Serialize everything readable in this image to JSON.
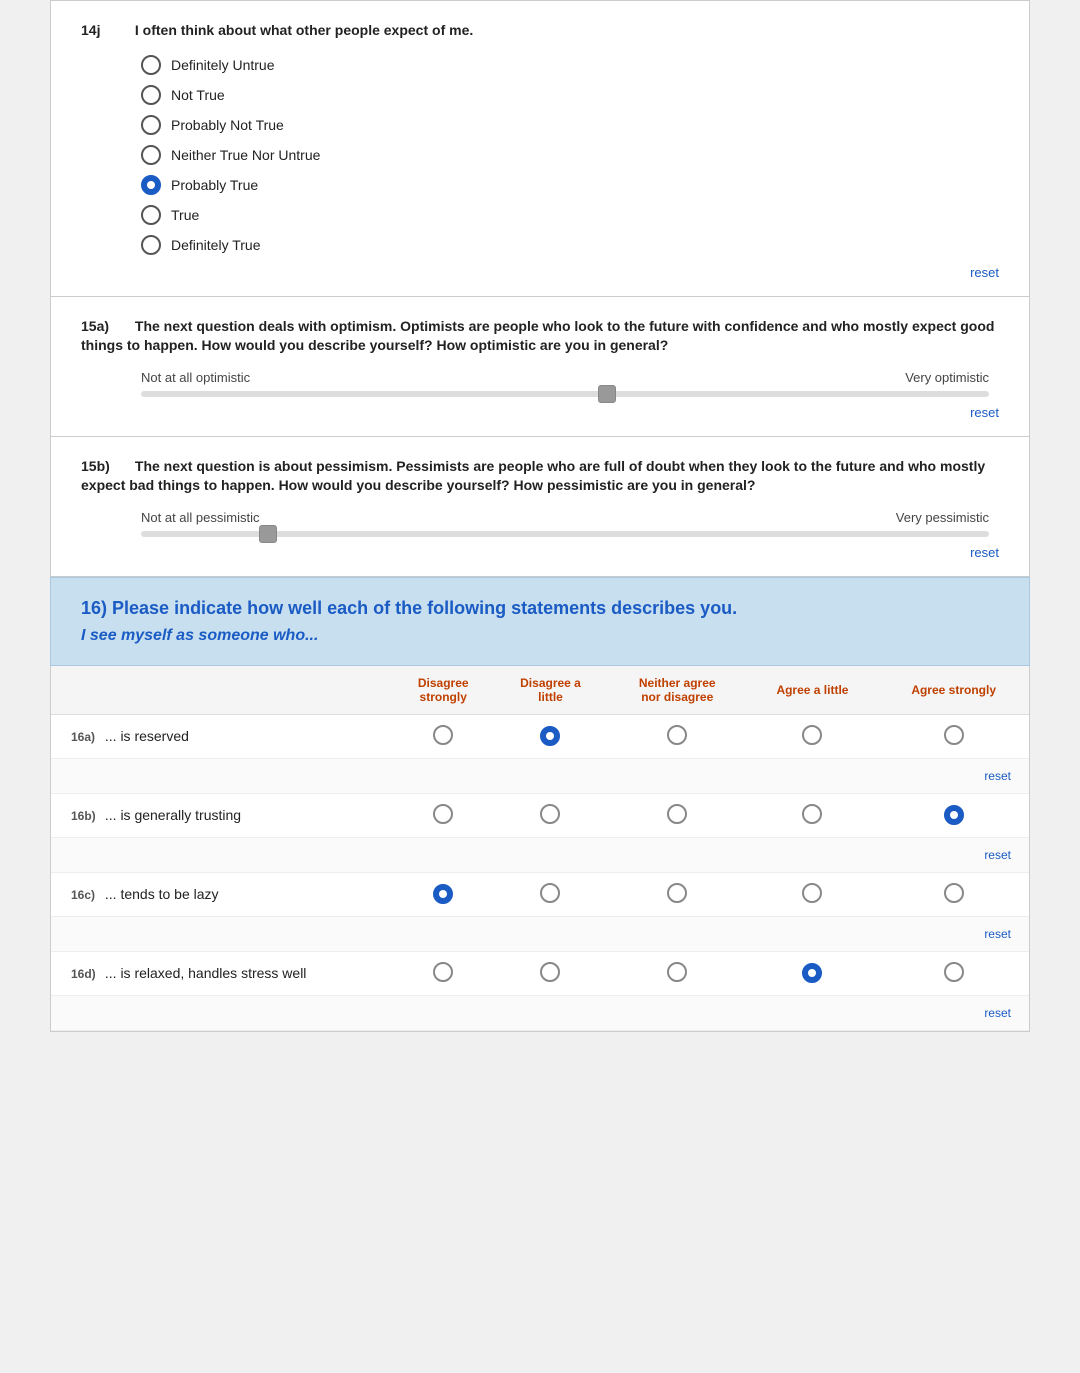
{
  "questions": {
    "q14j": {
      "id": "14j",
      "text": "I often think about what other people expect of me.",
      "options": [
        {
          "label": "Definitely Untrue",
          "selected": false
        },
        {
          "label": "Not True",
          "selected": false
        },
        {
          "label": "Probably Not True",
          "selected": false
        },
        {
          "label": "Neither True Nor Untrue",
          "selected": false
        },
        {
          "label": "Probably True",
          "selected": true
        },
        {
          "label": "True",
          "selected": false
        },
        {
          "label": "Definitely True",
          "selected": false
        }
      ],
      "reset_label": "reset"
    },
    "q15a": {
      "id": "15a",
      "text": "The next question deals with optimism. Optimists are people who look to the future with confidence and who mostly expect good things to happen. How would you describe yourself? How optimistic are you in general?",
      "left_label": "Not at all optimistic",
      "right_label": "Very optimistic",
      "thumb_percent": 55,
      "reset_label": "reset"
    },
    "q15b": {
      "id": "15b",
      "text": "The next question is about pessimism. Pessimists are people who are full of doubt when they look to the future and who mostly expect bad things to happen. How would you describe yourself? How pessimistic are you in general?",
      "left_label": "Not at all pessimistic",
      "right_label": "Very pessimistic",
      "thumb_percent": 15,
      "reset_label": "reset"
    }
  },
  "section16": {
    "title": "16) Please indicate how well each of the following statements describes you.",
    "subtitle": "I see myself as someone who...",
    "columns": [
      {
        "label": "Disagree strongly",
        "key": "ds"
      },
      {
        "label": "Disagree a little",
        "key": "dl"
      },
      {
        "label": "Neither agree nor disagree",
        "key": "n"
      },
      {
        "label": "Agree a little",
        "key": "al"
      },
      {
        "label": "Agree strongly",
        "key": "as"
      }
    ],
    "rows": [
      {
        "id": "16a",
        "statement": "... is reserved",
        "selected": "dl",
        "reset_label": "reset"
      },
      {
        "id": "16b",
        "statement": "... is generally trusting",
        "selected": "as",
        "reset_label": "reset"
      },
      {
        "id": "16c",
        "statement": "... tends to be lazy",
        "selected": "ds",
        "reset_label": "reset"
      },
      {
        "id": "16d",
        "statement": "... is relaxed, handles stress well",
        "selected": "al",
        "reset_label": "reset"
      }
    ]
  }
}
